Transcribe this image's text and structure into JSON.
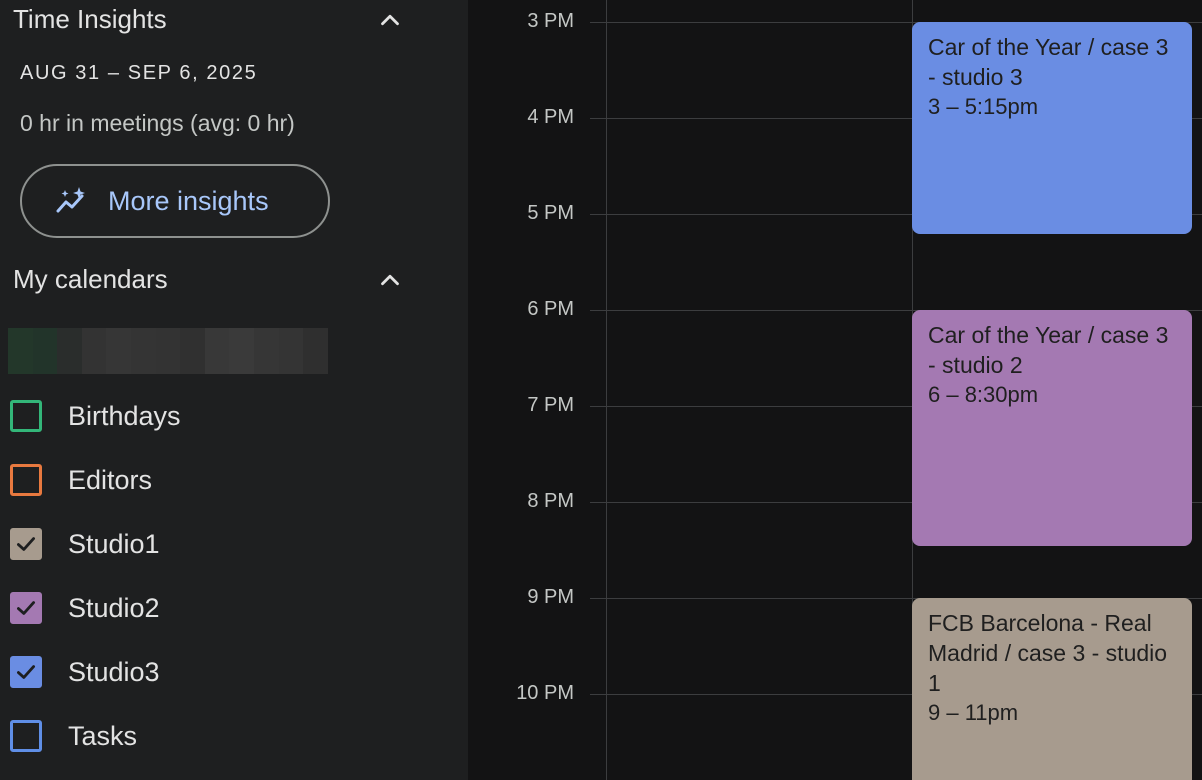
{
  "time_insights": {
    "header": "Time Insights",
    "date_range": "AUG 31 – SEP 6, 2025",
    "meetings_text": "0 hr in meetings (avg: 0 hr)",
    "more_insights_label": "More insights",
    "collapse_icon": "chevron-up-icon",
    "insights_icon": "sparkle-chart-icon"
  },
  "my_calendars": {
    "header": "My calendars",
    "collapse_icon": "chevron-up-icon",
    "items": [
      {
        "label": "Birthdays",
        "color": "#33b679",
        "checked": false
      },
      {
        "label": "Editors",
        "color": "#e8793f",
        "checked": false
      },
      {
        "label": "Studio1",
        "color": "#a79b8e",
        "checked": true
      },
      {
        "label": "Studio2",
        "color": "#a479b2",
        "checked": true
      },
      {
        "label": "Studio3",
        "color": "#6a8de3",
        "checked": true
      },
      {
        "label": "Tasks",
        "color": "#5f8ee6",
        "checked": false
      }
    ]
  },
  "time_labels": [
    "3 PM",
    "4 PM",
    "5 PM",
    "6 PM",
    "7 PM",
    "8 PM",
    "9 PM",
    "10 PM"
  ],
  "events": [
    {
      "title": "Car of the Year / case 3 - studio 3",
      "time": "3 – 5:15pm",
      "color": "#6a8de3"
    },
    {
      "title": "Car of the Year / case 3 - studio 2",
      "time": "6 – 8:30pm",
      "color": "#a479b2"
    },
    {
      "title": "FCB Barcelona - Real Madrid / case 3 - studio 1",
      "time": "9 – 11pm",
      "color": "#a79b8e"
    }
  ]
}
